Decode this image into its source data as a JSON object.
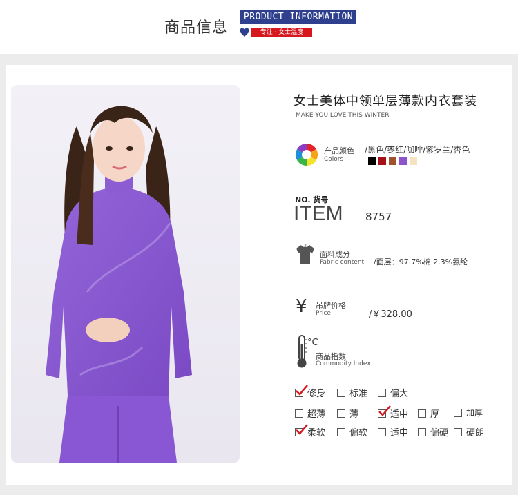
{
  "header": {
    "title_cn": "商品信息",
    "title_en": "PRODUCT INFORMATION",
    "tag": "专注 · 女士温度"
  },
  "product": {
    "title": "女士美体中领单层薄款内衣套装",
    "subtitle": "MAKE YOU LOVE THIS WINTER"
  },
  "colors": {
    "label_cn": "产品颜色",
    "label_en": "Colors",
    "list": "/黑色/枣红/咖啡/紫罗兰/杏色",
    "swatches": [
      "#000000",
      "#a50f17",
      "#a0522d",
      "#8e54c9",
      "#f6e2c0"
    ]
  },
  "item": {
    "no_label": "NO. 货号",
    "big_label": "ITEM",
    "value": "8757"
  },
  "fabric": {
    "label_cn": "面料成分",
    "label_en": "Fabric content",
    "value": "/面层：97.7%棉  2.3%氨纶"
  },
  "price": {
    "icon": "¥",
    "label_cn": "吊牌价格",
    "label_en": "Price",
    "value": "/￥328.00"
  },
  "index": {
    "label_c": "°C",
    "label_cn": "商品指数",
    "label_en": "Commodity Index",
    "options": [
      {
        "label": "修身",
        "checked": true
      },
      {
        "label": "标准",
        "checked": false
      },
      {
        "label": "偏大",
        "checked": false
      },
      {
        "label": "超薄",
        "checked": false
      },
      {
        "label": "薄",
        "checked": false
      },
      {
        "label": "适中",
        "checked": true
      },
      {
        "label": "厚",
        "checked": false
      },
      {
        "label": "加厚",
        "checked": false
      },
      {
        "label": "柔软",
        "checked": true
      },
      {
        "label": "偏软",
        "checked": false
      },
      {
        "label": "适中",
        "checked": false
      },
      {
        "label": "偏硬",
        "checked": false
      },
      {
        "label": "硬朗",
        "checked": false
      }
    ]
  },
  "icons": {
    "heart": "heart-icon",
    "color_wheel": "color-wheel-icon",
    "shirt": "shirt-icon",
    "yen": "yen-icon",
    "thermometer": "thermometer-icon",
    "checkmark": "checkmark-icon"
  },
  "accent": "#2e3f8e",
  "tag_color": "#d6171e"
}
